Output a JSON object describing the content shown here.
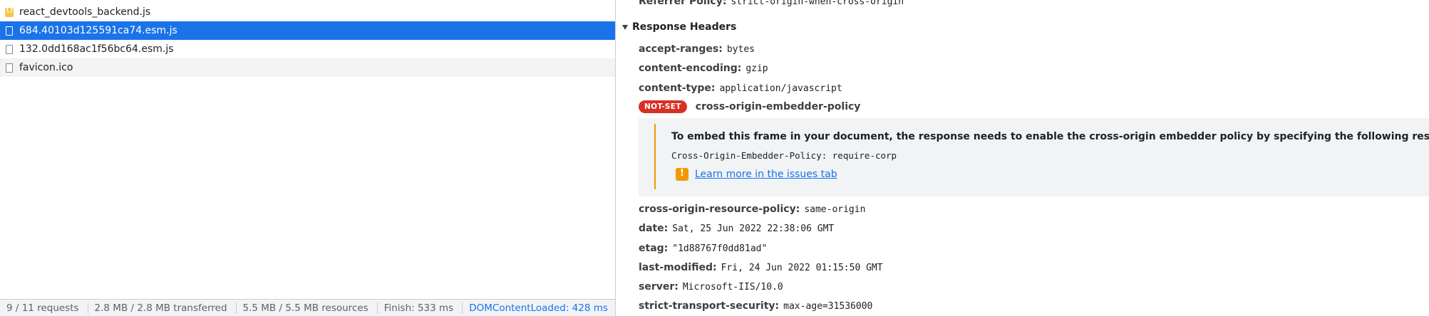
{
  "requests": [
    {
      "name": "react_devtools_backend.js",
      "icon": "js-file-icon",
      "selected": false
    },
    {
      "name": "684.40103d125591ca74.esm.js",
      "icon": "file-icon",
      "selected": true
    },
    {
      "name": "132.0dd168ac1f56bc64.esm.js",
      "icon": "file-icon",
      "selected": false
    },
    {
      "name": "favicon.ico",
      "icon": "file-icon",
      "selected": false
    }
  ],
  "status_bar": {
    "requests": "9 / 11 requests",
    "transferred": "2.8 MB / 2.8 MB transferred",
    "resources": "5.5 MB / 5.5 MB resources",
    "finish": "Finish: 533 ms",
    "dom_content_loaded": "DOMContentLoaded: 428 ms"
  },
  "referrer": {
    "name": "Referrer Policy:",
    "value": "strict-origin-when-cross-origin"
  },
  "response_headers_title": "Response Headers",
  "headers_top": [
    {
      "name": "accept-ranges:",
      "value": "bytes"
    },
    {
      "name": "content-encoding:",
      "value": "gzip"
    },
    {
      "name": "content-type:",
      "value": "application/javascript"
    }
  ],
  "not_set": {
    "badge": "NOT-SET",
    "name": "cross-origin-embedder-policy",
    "message": "To embed this frame in your document, the response needs to enable the cross-origin embedder policy by specifying the following response header:",
    "code": "Cross-Origin-Embedder-Policy: require-corp",
    "link": "Learn more in the issues tab"
  },
  "headers_bottom": [
    {
      "name": "cross-origin-resource-policy:",
      "value": "same-origin"
    },
    {
      "name": "date:",
      "value": "Sat, 25 Jun 2022 22:38:06 GMT"
    },
    {
      "name": "etag:",
      "value": "\"1d88767f0dd81ad\""
    },
    {
      "name": "last-modified:",
      "value": "Fri, 24 Jun 2022 01:15:50 GMT"
    },
    {
      "name": "server:",
      "value": "Microsoft-IIS/10.0"
    },
    {
      "name": "strict-transport-security:",
      "value": "max-age=31536000"
    }
  ],
  "colors": {
    "selected_row": "#1a73e8",
    "not_set_badge": "#d93025",
    "warning_accent": "#f29900",
    "link": "#1a73e8"
  }
}
